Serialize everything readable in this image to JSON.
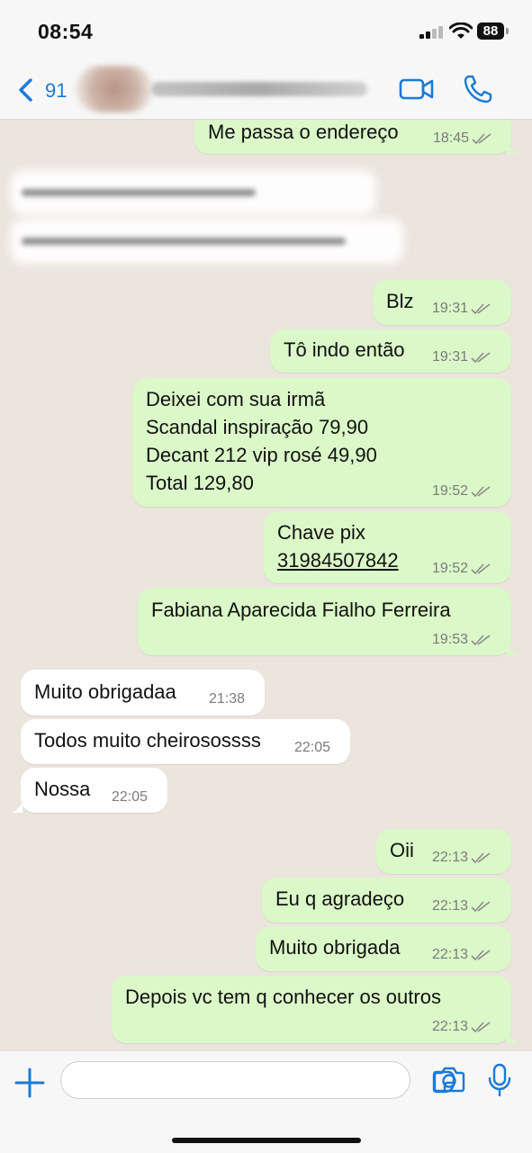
{
  "status_bar": {
    "time": "08:54",
    "battery": "88"
  },
  "header": {
    "back_count": "91",
    "contact_name": ""
  },
  "messages": [
    {
      "id": "m1",
      "dir": "out",
      "text": "Me passa o endereço",
      "time": "18:45"
    },
    {
      "id": "m2",
      "dir": "out",
      "text": "Blz",
      "time": "19:31"
    },
    {
      "id": "m3",
      "dir": "out",
      "text": "Tô indo então",
      "time": "19:31"
    },
    {
      "id": "m4",
      "dir": "out",
      "lines": [
        "Deixei com sua irmã",
        "Scandal inspiração 79,90",
        "Decant 212 vip rosé 49,90",
        "Total 129,80"
      ],
      "time": "19:52"
    },
    {
      "id": "m5",
      "dir": "out",
      "text": "Chave pix",
      "link": "31984507842",
      "time": "19:52"
    },
    {
      "id": "m6",
      "dir": "out",
      "text": "Fabiana Aparecida Fialho Ferreira",
      "time": "19:53"
    },
    {
      "id": "m7",
      "dir": "in",
      "text": "Muito obrigadaa",
      "time": "21:38"
    },
    {
      "id": "m8",
      "dir": "in",
      "text": "Todos muito cheirosossss",
      "time": "22:05"
    },
    {
      "id": "m9",
      "dir": "in",
      "text": "Nossa",
      "time": "22:05"
    },
    {
      "id": "m10",
      "dir": "out",
      "text": "Oii",
      "time": "22:13"
    },
    {
      "id": "m11",
      "dir": "out",
      "text": "Eu q agradeço",
      "time": "22:13"
    },
    {
      "id": "m12",
      "dir": "out",
      "text": "Muito obrigada",
      "time": "22:13"
    },
    {
      "id": "m13",
      "dir": "out",
      "text": "Depois vc tem q conhecer os outros",
      "time": "22:13"
    }
  ],
  "input": {
    "value": "",
    "placeholder": ""
  },
  "colors": {
    "outgoing_bubble": "#dbf8c8",
    "incoming_bubble": "#ffffff",
    "accent": "#1b7ad6",
    "background": "#ebe5de"
  },
  "icons": [
    "back-chevron-icon",
    "video-call-icon",
    "phone-icon",
    "plus-icon",
    "sticker-icon",
    "camera-icon",
    "microphone-icon",
    "read-ticks-icon"
  ]
}
